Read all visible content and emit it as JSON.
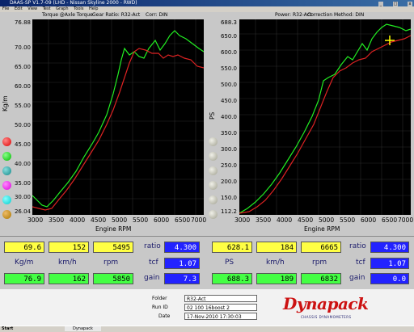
{
  "window": {
    "title": "DAAS-SP V1.7-09  (LHD - Nissan Skyline 2000 - RWD)"
  },
  "menu": [
    "File",
    "Edit",
    "View",
    "Test",
    "Graph",
    "Tools",
    "Help"
  ],
  "left_graph": {
    "header": [
      "Torque @Axle Torque",
      "Gear Ratio: R32-Act",
      "Corr: DIN"
    ],
    "y_ticks": [
      "76.88",
      "70.00",
      "65.00",
      "60.00",
      "55.00",
      "50.00",
      "45.00",
      "40.00",
      "35.00",
      "30.00",
      "26.04"
    ],
    "y_axis_title": "Kg/m",
    "x_ticks": [
      "3000",
      "3500",
      "4000",
      "4500",
      "5000",
      "5500",
      "6000",
      "6500",
      "7000"
    ],
    "x_axis_title": "Engine RPM"
  },
  "right_graph": {
    "header": [
      "Power: R32-Act",
      "Correction Method: DIN"
    ],
    "y_ticks": [
      "688.3",
      "650.0",
      "600.0",
      "550.0",
      "500.0",
      "450.0",
      "400.0",
      "350.0",
      "300.0",
      "250.0",
      "200.0",
      "150.0",
      "112.2"
    ],
    "y_axis_title": "PS",
    "x_ticks": [
      "3000",
      "3500",
      "4000",
      "4500",
      "5000",
      "5500",
      "6000",
      "6500",
      "7000"
    ],
    "x_axis_title": "Engine RPM"
  },
  "readouts_left": {
    "row1": [
      "69.6",
      "152",
      "5495"
    ],
    "ratio_label": "ratio",
    "ratio": "4.300",
    "units": [
      "Kg/m",
      "km/h",
      "rpm"
    ],
    "tcf_label": "tcf",
    "tcf": "1.07",
    "row3": [
      "76.9",
      "162",
      "5850"
    ],
    "gain_label": "gain",
    "gain": "7.3"
  },
  "readouts_right": {
    "row1": [
      "628.1",
      "184",
      "6665"
    ],
    "ratio_label": "ratio",
    "ratio": "4.300",
    "units": [
      "PS",
      "km/h",
      "rpm"
    ],
    "tcf_label": "tcf",
    "tcf": "1.07",
    "row3": [
      "688.3",
      "189",
      "6832"
    ],
    "gain_label": "gain",
    "gain": "0.0"
  },
  "info": {
    "folder_label": "Folder",
    "folder": "R32-Act",
    "runid_label": "Run ID",
    "runid": "02 100 16boost 2",
    "date_label": "Date",
    "date": "17-Nov-2010   17:30:03"
  },
  "logo": {
    "text": "Dynapack",
    "subtitle": "CHASSIS DYNAMOMETERS"
  },
  "taskbar": {
    "start": "Start",
    "task": "Dynapack"
  },
  "colors": {
    "run_green": "#22ee22",
    "run_red": "#dd2222",
    "panel": "#000000"
  }
}
